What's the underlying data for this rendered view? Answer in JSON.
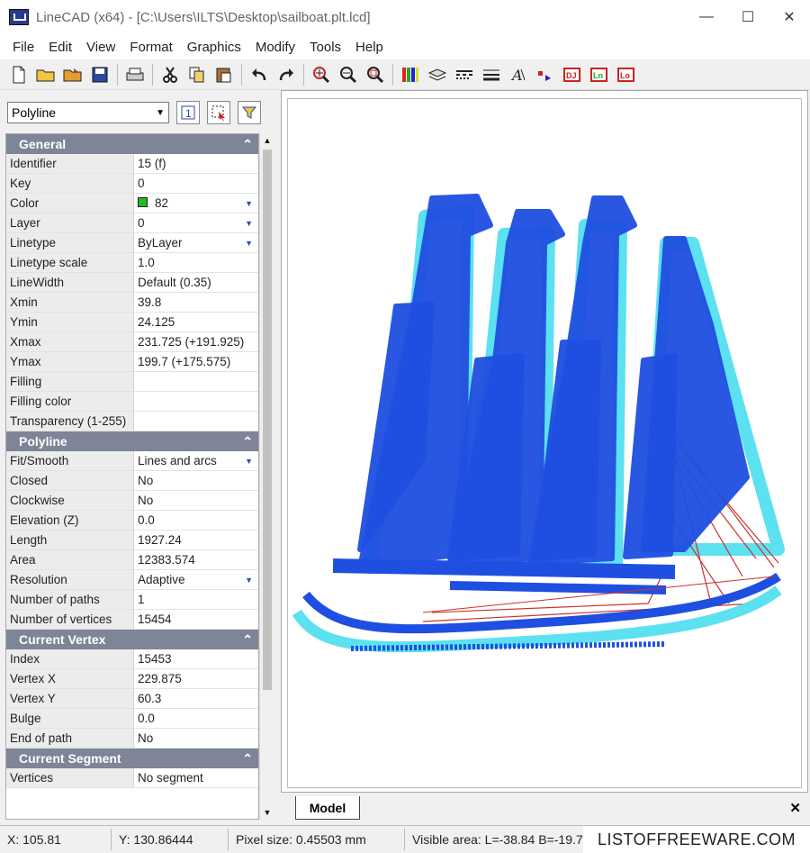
{
  "window": {
    "title": "LineCAD (x64) - [C:\\Users\\ILTS\\Desktop\\sailboat.plt.lcd]",
    "minimize": "—",
    "maximize": "☐",
    "close": "✕"
  },
  "menu": [
    "File",
    "Edit",
    "View",
    "Format",
    "Graphics",
    "Modify",
    "Tools",
    "Help"
  ],
  "toolbar": {
    "icons": [
      "new-file-icon",
      "open-folder-icon",
      "open-recent-icon",
      "save-icon",
      "print-icon",
      "cut-icon",
      "copy-icon",
      "paste-icon",
      "undo-icon",
      "redo-icon",
      "zoom-window-icon",
      "zoom-out-icon",
      "zoom-extents-icon",
      "color-bars-icon",
      "layers-icon",
      "linetypes-icon",
      "lineweight-icon",
      "text-style-icon",
      "point-icon",
      "filling-icon",
      "line-icon",
      "rect-icon"
    ]
  },
  "selector": {
    "value": "Polyline"
  },
  "properties": {
    "sections": [
      {
        "title": "General",
        "rows": [
          {
            "k": "Identifier",
            "v": "15 (f)"
          },
          {
            "k": "Key",
            "v": "0"
          },
          {
            "k": "Color",
            "v": "82",
            "swatch": "#22bb22",
            "dropdown": true
          },
          {
            "k": "Layer",
            "v": "0",
            "dropdown": true
          },
          {
            "k": "Linetype",
            "v": "ByLayer",
            "dropdown": true
          },
          {
            "k": "Linetype scale",
            "v": "1.0"
          },
          {
            "k": "LineWidth",
            "v": "Default (0.35)"
          },
          {
            "k": "Xmin",
            "v": "39.8"
          },
          {
            "k": "Ymin",
            "v": "24.125"
          },
          {
            "k": "Xmax",
            "v": "231.725  (+191.925)"
          },
          {
            "k": "Ymax",
            "v": "199.7  (+175.575)"
          },
          {
            "k": "Filling",
            "v": ""
          },
          {
            "k": "Filling color",
            "v": ""
          },
          {
            "k": "Transparency (1-255)",
            "v": ""
          }
        ]
      },
      {
        "title": "Polyline",
        "rows": [
          {
            "k": "Fit/Smooth",
            "v": "Lines and arcs",
            "dropdown": true
          },
          {
            "k": "Closed",
            "v": "No"
          },
          {
            "k": "Clockwise",
            "v": "No"
          },
          {
            "k": "Elevation (Z)",
            "v": "0.0"
          },
          {
            "k": "Length",
            "v": "1927.24"
          },
          {
            "k": "Area",
            "v": "12383.574"
          },
          {
            "k": "Resolution",
            "v": "Adaptive",
            "dropdown": true
          },
          {
            "k": "Number of paths",
            "v": "1"
          },
          {
            "k": "Number of vertices",
            "v": "15454"
          }
        ]
      },
      {
        "title": "Current Vertex",
        "rows": [
          {
            "k": "Index",
            "v": "15453"
          },
          {
            "k": "Vertex X",
            "v": "229.875"
          },
          {
            "k": "Vertex Y",
            "v": "60.3"
          },
          {
            "k": "Bulge",
            "v": "0.0"
          },
          {
            "k": "End of path",
            "v": "No"
          }
        ]
      },
      {
        "title": "Current Segment",
        "rows": [
          {
            "k": "Vertices",
            "v": "No segment"
          }
        ]
      }
    ],
    "collapse_glyph": "⌃"
  },
  "drawing": {
    "colors": {
      "primary": "#1f4fe0",
      "secondary": "#5ce1f0",
      "rigging": "#d03030"
    }
  },
  "tabs": {
    "model": "Model",
    "close": "✕"
  },
  "status": {
    "x": "X: 105.81",
    "y": "Y: 130.86444",
    "pixel": "Pixel size: 0.45503 mm",
    "visible": "Visible area:  L=-38.84  B=-19.7"
  },
  "watermark": "LISTOFFREEWARE.COM"
}
